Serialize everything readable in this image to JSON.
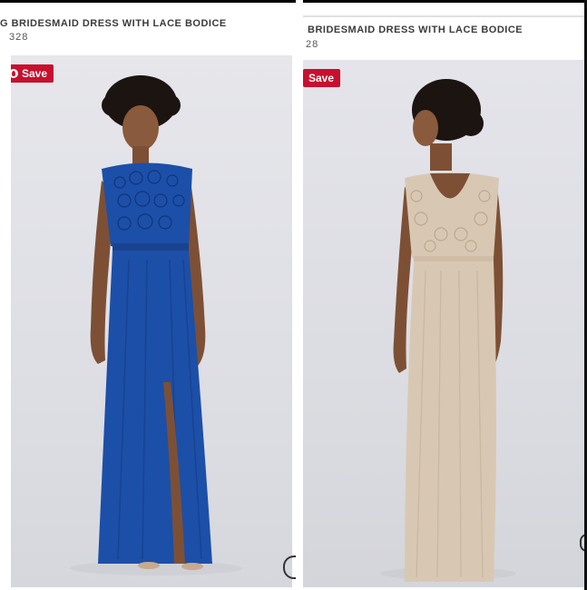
{
  "left_card": {
    "title": "G BRIDESMAID DRESS WITH LACE BODICE",
    "price": "328",
    "save_label": "Save",
    "dress_color": "#1c4fa8"
  },
  "right_card": {
    "title": "BRIDESMAID DRESS WITH LACE BODICE",
    "price": "28",
    "save_label": "Save",
    "dress_color": "#d8c8b3"
  },
  "colors": {
    "save_red": "#c8102e",
    "text": "#3b3b3b"
  }
}
